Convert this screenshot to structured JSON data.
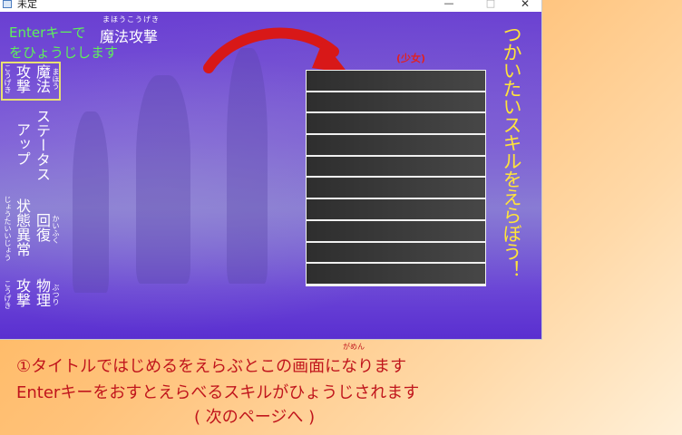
{
  "window": {
    "title": "未定",
    "minimize": "—",
    "maximize": "□",
    "close": "✕"
  },
  "game": {
    "hint_line1": "Enterキーで",
    "hint_line2": "をひょうじします",
    "skill_name": "魔法攻撃",
    "skill_name_ruby": "まほうこうげき",
    "girl_label": "(少女)",
    "side_title": "つかいたいスキルをえらぼう！",
    "commands": [
      {
        "name": "魔法攻撃",
        "col1": "魔法",
        "col2": "攻撃",
        "ruby1": "まほう",
        "ruby2": "こうげき",
        "selected": true
      },
      {
        "name": "ステータスアップ",
        "col1": "ステータス",
        "col2": "アップ",
        "selected": false
      },
      {
        "name": "状態異常回復",
        "col1": "回復",
        "col2": "状態異常",
        "ruby1": "かいふく",
        "ruby2": "じょうたいいじょう",
        "selected": false
      },
      {
        "name": "物理攻撃",
        "col1": "物理",
        "col2": "攻撃",
        "ruby1": "ぶつり",
        "ruby2": "こうげき",
        "selected": false
      }
    ],
    "skill_slots": [
      "",
      "",
      "",
      "",
      "",
      "",
      "",
      "",
      "",
      ""
    ],
    "arrow_color": "#d81818"
  },
  "caption": {
    "line1": "①タイトルではじめるをえらぶとこの画面になります",
    "line1_ruby": "がめん",
    "line2": "Enterキーをおすとえらべるスキルがひょうじされます",
    "line3": "( 次のページへ )",
    "color": "#c0151c"
  }
}
